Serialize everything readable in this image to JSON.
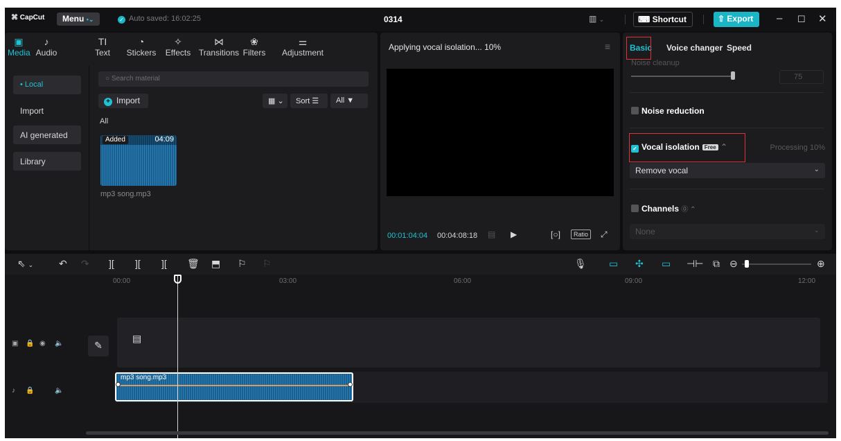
{
  "titlebar": {
    "logo": "CapCut",
    "menu": "Menu",
    "autosave": "Auto saved: 16:02:25",
    "project": "0314",
    "shortcut": "Shortcut",
    "export": "Export"
  },
  "tools": [
    {
      "label": "Media",
      "icon": "▣"
    },
    {
      "label": "Audio",
      "icon": "♪"
    },
    {
      "label": "Text",
      "icon": "TI"
    },
    {
      "label": "Stickers",
      "icon": "◔"
    },
    {
      "label": "Effects",
      "icon": "✧"
    },
    {
      "label": "Transitions",
      "icon": "⋈"
    },
    {
      "label": "Filters",
      "icon": "❀"
    },
    {
      "label": "Adjustment",
      "icon": "⚌"
    }
  ],
  "sidebar": {
    "local": "• Local",
    "import": "Import",
    "ai": "AI generated",
    "library": "Library"
  },
  "media": {
    "search_placeholder": "Search material",
    "import": "Import",
    "sort": "Sort",
    "all_filter": "All",
    "all_label": "All",
    "item": {
      "badge": "Added",
      "duration": "04:09",
      "name": "mp3 song.mp3"
    }
  },
  "player": {
    "status": "Applying vocal isolation... 10%",
    "time_current": "00:01:04:04",
    "time_total": "00:04:08:18",
    "ratio": "Ratio"
  },
  "props": {
    "tabs": [
      "Basic",
      "Voice changer",
      "Speed"
    ],
    "noise_cleanup": "Noise cleanup",
    "noise_value": "75",
    "noise_reduction": "Noise reduction",
    "vocal_isolation": "Vocal isolation",
    "free": "Free",
    "processing": "Processing 10%",
    "remove_vocal": "Remove vocal",
    "channels": "Channels",
    "channels_value": "None"
  },
  "timeline": {
    "ruler": [
      "00:00",
      "03:00",
      "06:00",
      "09:00",
      "12:00"
    ],
    "clip_name": "mp3 song.mp3"
  },
  "colors": {
    "accent": "#1fc2d3",
    "highlight": "#e0323b",
    "clip": "#1a5f8f"
  }
}
